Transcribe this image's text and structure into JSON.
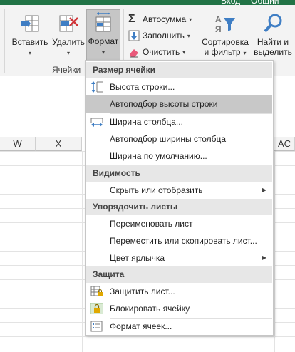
{
  "titlebar": {
    "signin": "Вход",
    "share": "Общий"
  },
  "ribbon": {
    "insert_label": "Вставить",
    "delete_label": "Удалить",
    "format_label": "Формат",
    "cells_group": "Ячейки",
    "autosum_label": "Автосумма",
    "fill_label": "Заполнить",
    "clear_label": "Очистить",
    "sort_label_1": "Сортировка",
    "sort_label_2": "и фильтр",
    "find_label_1": "Найти и",
    "find_label_2": "выделить"
  },
  "sheet": {
    "columns": [
      "W",
      "X",
      "AC"
    ]
  },
  "menu": {
    "section_size": "Размер ячейки",
    "row_height": "Высота строки...",
    "autofit_row": "Автоподбор высоты строки",
    "col_width": "Ширина столбца...",
    "autofit_col": "Автоподбор ширины столбца",
    "default_width": "Ширина по умолчанию...",
    "section_visibility": "Видимость",
    "hide_show": "Скрыть или отобразить",
    "section_sheets": "Упорядочить листы",
    "rename_sheet": "Переименовать лист",
    "move_copy_sheet": "Переместить или скопировать лист...",
    "tab_color": "Цвет ярлычка",
    "section_protect": "Защита",
    "protect_sheet": "Защитить лист...",
    "lock_cell": "Блокировать ячейку",
    "format_cells": "Формат ячеек..."
  },
  "colors": {
    "accent": "#217346",
    "selected_item": "#c8c8c8",
    "section_bg": "#e7e7e7"
  }
}
